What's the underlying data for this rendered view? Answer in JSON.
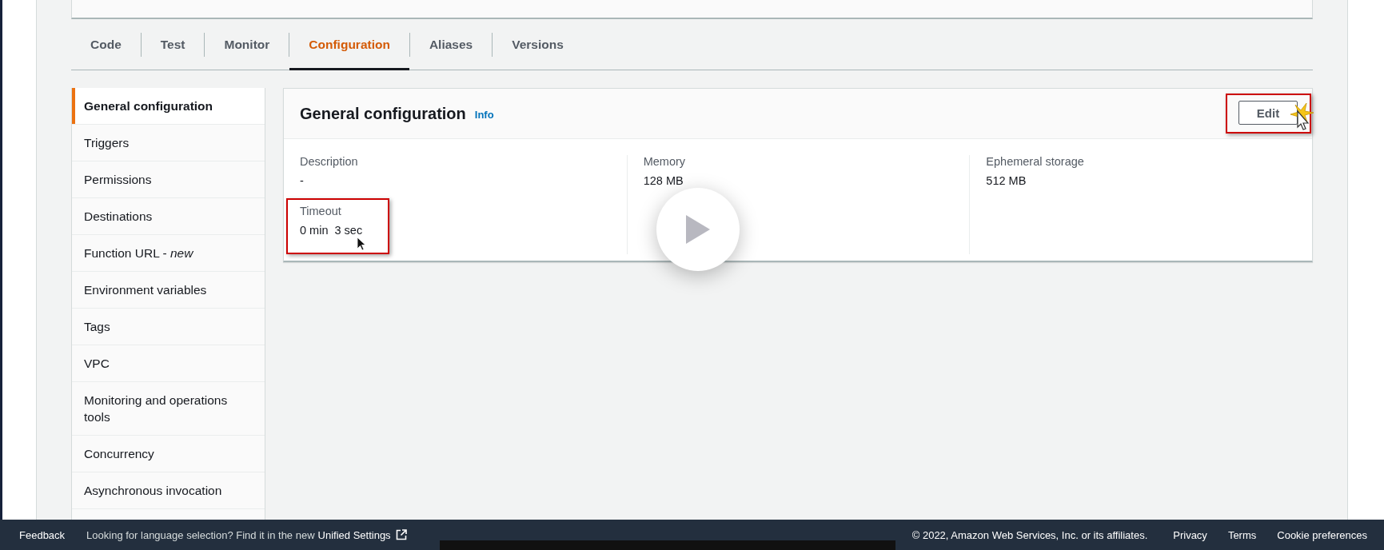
{
  "tabs": [
    {
      "label": "Code",
      "selected": false
    },
    {
      "label": "Test",
      "selected": false
    },
    {
      "label": "Monitor",
      "selected": false
    },
    {
      "label": "Configuration",
      "selected": true
    },
    {
      "label": "Aliases",
      "selected": false
    },
    {
      "label": "Versions",
      "selected": false
    }
  ],
  "sidebar": {
    "items": [
      {
        "label": "General configuration",
        "selected": true
      },
      {
        "label": "Triggers",
        "selected": false
      },
      {
        "label": "Permissions",
        "selected": false
      },
      {
        "label": "Destinations",
        "selected": false
      },
      {
        "label": "Function URL - *new*",
        "selected": false
      },
      {
        "label": "Environment variables",
        "selected": false
      },
      {
        "label": "Tags",
        "selected": false
      },
      {
        "label": "VPC",
        "selected": false
      },
      {
        "label": "Monitoring and operations tools",
        "selected": false
      },
      {
        "label": "Concurrency",
        "selected": false
      },
      {
        "label": "Asynchronous invocation",
        "selected": false
      }
    ]
  },
  "panel": {
    "title": "General configuration",
    "info_link": "Info",
    "edit_button": {
      "label": "Edit",
      "highlighted": true
    },
    "columns": [
      [
        {
          "label": "Description",
          "value": "-",
          "highlighted": false
        },
        {
          "label": "Timeout",
          "value": "0 min  3 sec",
          "highlighted": true
        }
      ],
      [
        {
          "label": "Memory",
          "value": "128 MB",
          "highlighted": false
        }
      ],
      [
        {
          "label": "Ephemeral storage",
          "value": "512 MB",
          "highlighted": false
        }
      ]
    ]
  },
  "footer": {
    "feedback": "Feedback",
    "notice": "Looking for language selection? Find it in the new",
    "link": "Unified Settings",
    "copyright": "© 2022, Amazon Web Services, Inc. or its affiliates.",
    "links": [
      "Privacy",
      "Terms",
      "Cookie preferences"
    ]
  }
}
